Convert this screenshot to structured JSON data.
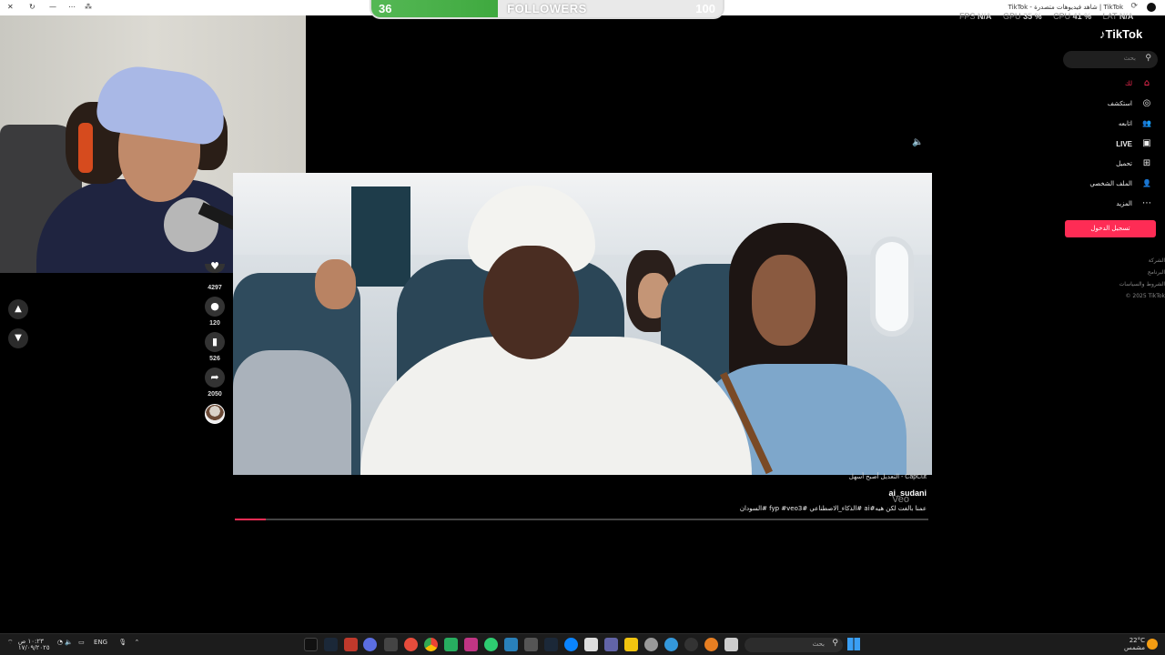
{
  "browser": {
    "tab_title": "TikTok | شاهد فيديوهات متصدرة - TikTok",
    "controls": [
      "✕",
      "↻",
      "—",
      "▢",
      "⋯",
      "🔗"
    ]
  },
  "followers_widget": {
    "current": "36",
    "label": "FOLLOWERS",
    "goal": "100",
    "progress_fraction": 0.36,
    "fill_color": "#4db34d"
  },
  "perf": {
    "fps_label": "FPS",
    "fps": "N/A",
    "gpu_label": "GPU",
    "gpu": "35 %",
    "cpu_label": "CPU",
    "cpu": "41 %",
    "lat_label": "LAT",
    "lat": "N/A"
  },
  "feed_nav": {
    "up_icon": "chevron-up-icon",
    "down_icon": "chevron-down-icon"
  },
  "actions": {
    "likes": "4297",
    "comments": "120",
    "saves": "526",
    "shares": "2050"
  },
  "video": {
    "capcut_label": "CapCut - التعديل أصبح أسهل",
    "author": "ai_sudani",
    "watermark": "Veo",
    "caption": "عمنا بالغت لكن هيه#ai #الذكاء_الاصطناعي #fyp #veo3 #السودان",
    "progress_fraction": 0.045,
    "accent": "#fe2c55"
  },
  "sidebar": {
    "logo": "TikTok",
    "search_placeholder": "بحث",
    "items": [
      {
        "label": "لك",
        "icon": "home-icon",
        "glyph": "⌂",
        "active": true
      },
      {
        "label": "استكشف",
        "icon": "compass-icon",
        "glyph": "◎",
        "active": false
      },
      {
        "label": "اتابعه",
        "icon": "following-icon",
        "glyph": "👥",
        "active": false
      },
      {
        "label": "LIVE",
        "icon": "live-icon",
        "glyph": "▣",
        "active": false
      },
      {
        "label": "تحميل",
        "icon": "upload-icon",
        "glyph": "⊞",
        "active": false
      },
      {
        "label": "الملف الشخصي",
        "icon": "profile-icon",
        "glyph": "👤",
        "active": false
      },
      {
        "label": "المزيد",
        "icon": "more-icon",
        "glyph": "⋯",
        "active": false
      }
    ],
    "login_label": "تسجيل الدخول",
    "footer": [
      "الشركة",
      "البرنامج",
      "الشروط والسياسات",
      "© 2025 TikTok"
    ]
  },
  "taskbar": {
    "time": "١٠:٢٣ ص",
    "date": "١٧/٠٩/٢٠٢٥",
    "lang": "ENG",
    "search_placeholder": "بحث",
    "temp": "22°C",
    "weather": "مشمس"
  }
}
